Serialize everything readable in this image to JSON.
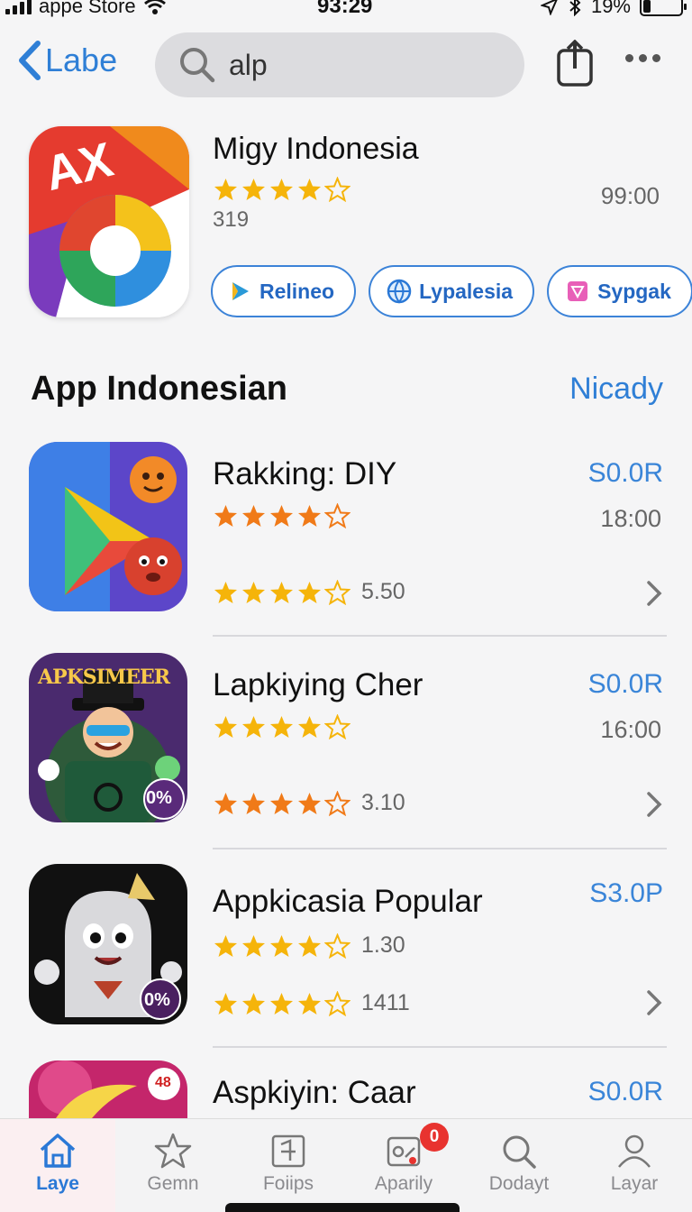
{
  "status": {
    "carrier": "appe Store",
    "time": "93:29",
    "battery": "19%",
    "battery_level": 0.19
  },
  "nav": {
    "back_label": "Labe",
    "search_value": "alp"
  },
  "featured": {
    "name": "Migy Indonesia",
    "rating_count": "319",
    "time": "99:00",
    "stars": 4,
    "icon_text": "AX",
    "chips": [
      {
        "label": "Relineo",
        "icon": "arrow-play-icon"
      },
      {
        "label": "Lypalesia",
        "icon": "globe-icon"
      },
      {
        "label": "Sypgak",
        "icon": "cube-icon"
      }
    ]
  },
  "section": {
    "title": "App Indonesian",
    "link": "Nicady"
  },
  "apps": [
    {
      "name": "Rakking: DIY",
      "price": "S0.0R",
      "time": "18:00",
      "rating": "5.50",
      "icon": "play-monsters-icon"
    },
    {
      "name": "Lapkiying Cher",
      "price": "S0.0R",
      "time": "16:00",
      "rating": "3.10",
      "icon_text": "APKSIMEER",
      "icon_badge": "0%",
      "icon": "magician-icon"
    },
    {
      "name": "Appkicasia Popular",
      "price": "S3.0P",
      "rating_top": "1.30",
      "rating": "1411",
      "icon_badge": "0%",
      "icon": "ghost-icon"
    },
    {
      "name": "Aspkiyin: Caar",
      "price": "S0.0R",
      "icon_badge": "48",
      "icon": "banana-icon"
    }
  ],
  "tabs": [
    {
      "label": "Laye",
      "icon": "home-icon",
      "active": true
    },
    {
      "label": "Gemn",
      "icon": "star-icon"
    },
    {
      "label": "Foiips",
      "icon": "document-icon"
    },
    {
      "label": "Aparily",
      "icon": "apps-icon",
      "badge": "0"
    },
    {
      "label": "Dodayt",
      "icon": "search-icon"
    },
    {
      "label": "Layar",
      "icon": "person-icon"
    }
  ],
  "colors": {
    "accent": "#2f7fd6",
    "star_gold": "#f5b40a",
    "star_orange": "#f07a18",
    "badge": "#e8332f"
  }
}
